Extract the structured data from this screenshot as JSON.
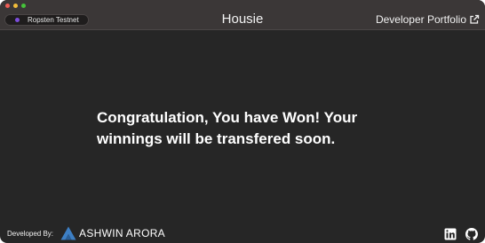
{
  "titlebar": {
    "network_label": "Ropsten Testnet",
    "app_title": "Housie",
    "portfolio_link": "Developer Portfolio"
  },
  "main": {
    "message": "Congratulation, You have Won! Your winnings will be transfered soon."
  },
  "footer": {
    "developed_by": "Developed By:",
    "developer_name": "ASHWIN ARORA"
  },
  "icons": [
    "external-link-icon",
    "linkedin-icon",
    "github-icon"
  ],
  "colors": {
    "background": "#262626",
    "titlebar": "#3b3737",
    "network_dot": "#7c4ddb",
    "logo": "#3d7fc4"
  }
}
